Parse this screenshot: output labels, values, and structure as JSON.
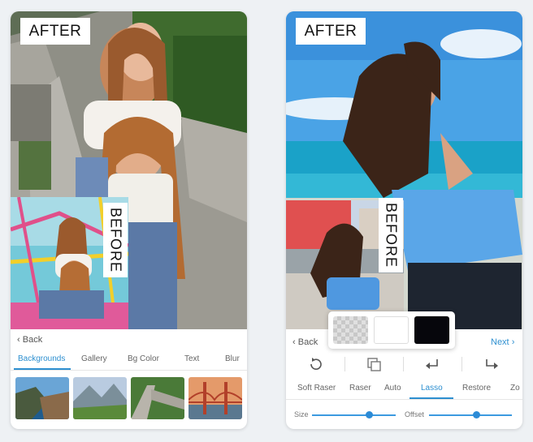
{
  "left_phone": {
    "after_label": "AFTER",
    "before_label": "BEFORE",
    "back_label": "Back",
    "tabs": [
      {
        "label": "Backgrounds",
        "active": true
      },
      {
        "label": "Gallery",
        "active": false
      },
      {
        "label": "Bg Color",
        "active": false
      },
      {
        "label": "Text",
        "active": false
      },
      {
        "label": "Blur",
        "active": false
      }
    ],
    "thumbnails": [
      "coastal-cliffs",
      "mountain-valley",
      "great-wall",
      "golden-gate-bridge"
    ]
  },
  "right_phone": {
    "after_label": "AFTER",
    "before_label": "BEFORE",
    "back_label": "Back",
    "next_label": "Next",
    "tools": [
      "Soft Raser",
      "Raser",
      "Auto",
      "Lasso",
      "Restore",
      "Zo"
    ],
    "active_tool": "Lasso",
    "size_label": "Size",
    "size_value": 0.68,
    "offset_label": "Offset",
    "offset_value": 0.57,
    "swatches": [
      "transparent",
      "white",
      "black"
    ]
  },
  "colors": {
    "accent": "#2d8fd0",
    "background": "#eef1f4"
  }
}
